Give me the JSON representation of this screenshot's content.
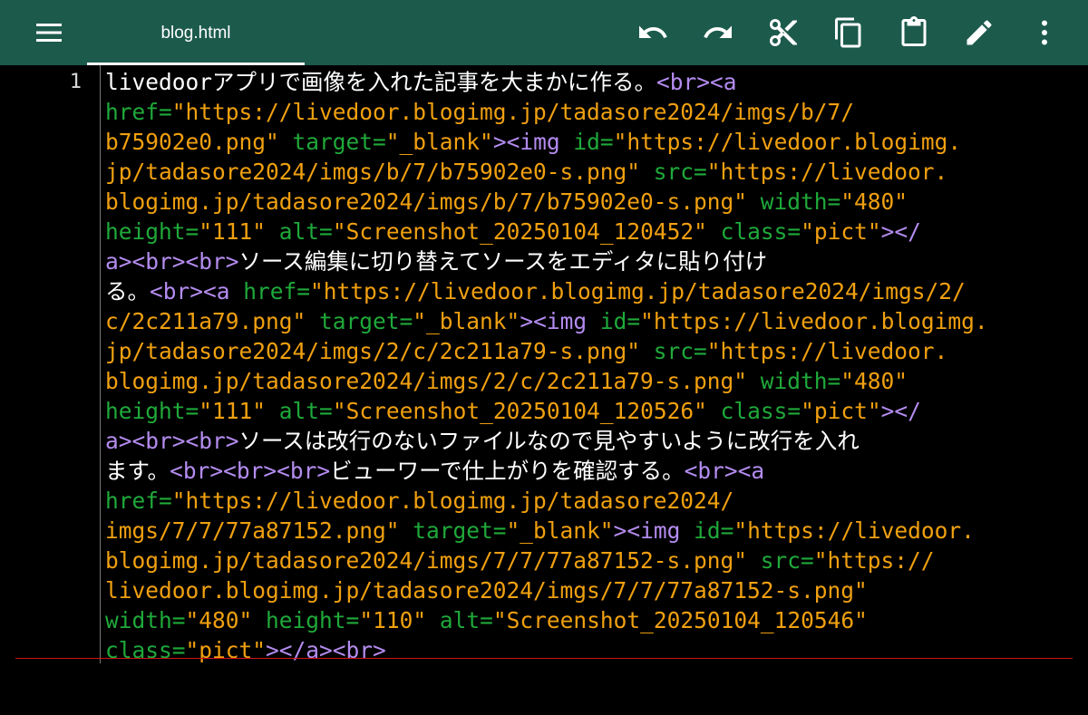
{
  "app": {
    "tab_title": "blog.html",
    "colors": {
      "toolbar_bg": "#1c5a4c",
      "editor_bg": "#000000",
      "text": "#ffffff",
      "tag": "#b48cf0",
      "attribute": "#1fa93a",
      "value": "#f0a010",
      "cursor_line": "#d0101a"
    },
    "icons": [
      "menu-icon",
      "undo-icon",
      "redo-icon",
      "cut-icon",
      "copy-icon",
      "paste-icon",
      "edit-pencil-icon",
      "more-vertical-icon"
    ]
  },
  "editor": {
    "line_number": "1",
    "rows": [
      [
        [
          "text",
          "livedoorアプリで画像を入れた記事を大まかに作る。"
        ],
        [
          "tag",
          "<br><a"
        ]
      ],
      [
        [
          "attr",
          "href="
        ],
        [
          "val",
          "\"https://livedoor.blogimg.jp/tadasore2024/imgs/b/7/"
        ]
      ],
      [
        [
          "val",
          "b75902e0.png\""
        ],
        [
          "text",
          " "
        ],
        [
          "attr",
          "target="
        ],
        [
          "val",
          "\"_blank\""
        ],
        [
          "tag",
          "><img"
        ],
        [
          "text",
          " "
        ],
        [
          "attr",
          "id="
        ],
        [
          "val",
          "\"https://livedoor.blogimg."
        ]
      ],
      [
        [
          "val",
          "jp/tadasore2024/imgs/b/7/b75902e0-s.png\""
        ],
        [
          "text",
          " "
        ],
        [
          "attr",
          "src="
        ],
        [
          "val",
          "\"https://livedoor."
        ]
      ],
      [
        [
          "val",
          "blogimg.jp/tadasore2024/imgs/b/7/b75902e0-s.png\""
        ],
        [
          "text",
          " "
        ],
        [
          "attr",
          "width="
        ],
        [
          "val",
          "\"480\""
        ]
      ],
      [
        [
          "attr",
          "height="
        ],
        [
          "val",
          "\"111\""
        ],
        [
          "text",
          " "
        ],
        [
          "attr",
          "alt="
        ],
        [
          "val",
          "\"Screenshot_20250104_120452\""
        ],
        [
          "text",
          " "
        ],
        [
          "attr",
          "class="
        ],
        [
          "val",
          "\"pict\""
        ],
        [
          "tag",
          "></"
        ]
      ],
      [
        [
          "tag",
          "a><br><br>"
        ],
        [
          "text",
          "ソース編集に切り替えてソースをエディタに貼り付け"
        ]
      ],
      [
        [
          "text",
          "る。"
        ],
        [
          "tag",
          "<br><a"
        ],
        [
          "text",
          " "
        ],
        [
          "attr",
          "href="
        ],
        [
          "val",
          "\"https://livedoor.blogimg.jp/tadasore2024/imgs/2/"
        ]
      ],
      [
        [
          "val",
          "c/2c211a79.png\""
        ],
        [
          "text",
          " "
        ],
        [
          "attr",
          "target="
        ],
        [
          "val",
          "\"_blank\""
        ],
        [
          "tag",
          "><img"
        ],
        [
          "text",
          " "
        ],
        [
          "attr",
          "id="
        ],
        [
          "val",
          "\"https://livedoor.blogimg."
        ]
      ],
      [
        [
          "val",
          "jp/tadasore2024/imgs/2/c/2c211a79-s.png\""
        ],
        [
          "text",
          " "
        ],
        [
          "attr",
          "src="
        ],
        [
          "val",
          "\"https://livedoor."
        ]
      ],
      [
        [
          "val",
          "blogimg.jp/tadasore2024/imgs/2/c/2c211a79-s.png\""
        ],
        [
          "text",
          " "
        ],
        [
          "attr",
          "width="
        ],
        [
          "val",
          "\"480\""
        ]
      ],
      [
        [
          "attr",
          "height="
        ],
        [
          "val",
          "\"111\""
        ],
        [
          "text",
          " "
        ],
        [
          "attr",
          "alt="
        ],
        [
          "val",
          "\"Screenshot_20250104_120526\""
        ],
        [
          "text",
          " "
        ],
        [
          "attr",
          "class="
        ],
        [
          "val",
          "\"pict\""
        ],
        [
          "tag",
          "></"
        ]
      ],
      [
        [
          "tag",
          "a><br><br>"
        ],
        [
          "text",
          "ソースは改行のないファイルなので見やすいように改行を入れ"
        ]
      ],
      [
        [
          "text",
          "ます。"
        ],
        [
          "tag",
          "<br><br><br>"
        ],
        [
          "text",
          "ビューワーで仕上がりを確認する。"
        ],
        [
          "tag",
          "<br><a"
        ]
      ],
      [
        [
          "attr",
          "href="
        ],
        [
          "val",
          "\"https://livedoor.blogimg.jp/tadasore2024/"
        ]
      ],
      [
        [
          "val",
          "imgs/7/7/77a87152.png\""
        ],
        [
          "text",
          " "
        ],
        [
          "attr",
          "target="
        ],
        [
          "val",
          "\"_blank\""
        ],
        [
          "tag",
          "><img"
        ],
        [
          "text",
          " "
        ],
        [
          "attr",
          "id="
        ],
        [
          "val",
          "\"https://livedoor."
        ]
      ],
      [
        [
          "val",
          "blogimg.jp/tadasore2024/imgs/7/7/77a87152-s.png\""
        ],
        [
          "text",
          " "
        ],
        [
          "attr",
          "src="
        ],
        [
          "val",
          "\"https://"
        ]
      ],
      [
        [
          "val",
          "livedoor.blogimg.jp/tadasore2024/imgs/7/7/77a87152-s.png\""
        ]
      ],
      [
        [
          "attr",
          "width="
        ],
        [
          "val",
          "\"480\""
        ],
        [
          "text",
          " "
        ],
        [
          "attr",
          "height="
        ],
        [
          "val",
          "\"110\""
        ],
        [
          "text",
          " "
        ],
        [
          "attr",
          "alt="
        ],
        [
          "val",
          "\"Screenshot_20250104_120546\""
        ]
      ],
      [
        [
          "attr",
          "class="
        ],
        [
          "val",
          "\"pict\""
        ],
        [
          "tag",
          "></a><br>"
        ]
      ]
    ]
  }
}
